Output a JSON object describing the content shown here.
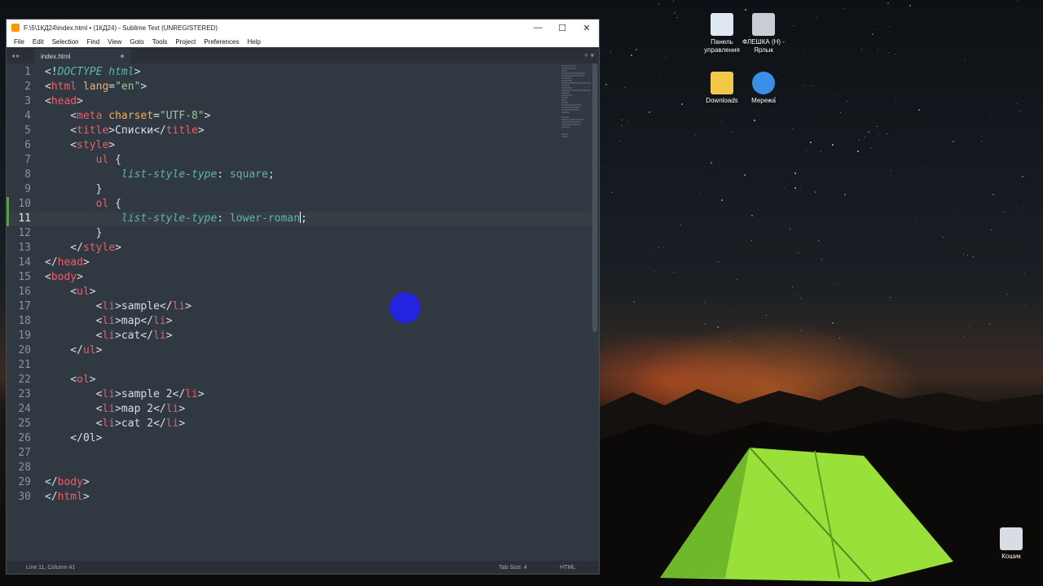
{
  "window": {
    "title": "F:\\5\\1КД24\\index.html • (1КД24) - Sublime Text (UNREGISTERED)",
    "controls": {
      "minimize": "—",
      "maximize": "☐",
      "close": "✕"
    }
  },
  "menu": [
    "File",
    "Edit",
    "Selection",
    "Find",
    "View",
    "Goto",
    "Tools",
    "Project",
    "Preferences",
    "Help"
  ],
  "tab": {
    "label": "index.html"
  },
  "code_lines": [
    [
      [
        "<!",
        "t-pun"
      ],
      [
        "DOCTYPE",
        "t-dt"
      ],
      [
        " ",
        "t-pun"
      ],
      [
        "html",
        "t-dt"
      ],
      [
        ">",
        "t-pun"
      ]
    ],
    [
      [
        "<",
        "t-pun"
      ],
      [
        "html",
        "t-tag"
      ],
      [
        " ",
        "t-pun"
      ],
      [
        "lang",
        "t-attr"
      ],
      [
        "=",
        "t-pun"
      ],
      [
        "\"en\"",
        "t-str"
      ],
      [
        ">",
        "t-pun"
      ]
    ],
    [
      [
        "<",
        "t-pun"
      ],
      [
        "head",
        "t-tag"
      ],
      [
        ">",
        "t-pun"
      ]
    ],
    [
      [
        "    <",
        "t-pun"
      ],
      [
        "meta",
        "t-tag"
      ],
      [
        " ",
        "t-pun"
      ],
      [
        "charset",
        "t-attr"
      ],
      [
        "=",
        "t-pun"
      ],
      [
        "\"UTF-8\"",
        "t-str"
      ],
      [
        ">",
        "t-pun"
      ]
    ],
    [
      [
        "    <",
        "t-pun"
      ],
      [
        "title",
        "t-tag"
      ],
      [
        ">Списки</",
        "t-pun"
      ],
      [
        "title",
        "t-tag"
      ],
      [
        ">",
        "t-pun"
      ]
    ],
    [
      [
        "    <",
        "t-pun"
      ],
      [
        "style",
        "t-tag"
      ],
      [
        ">",
        "t-pun"
      ]
    ],
    [
      [
        "        ",
        "t-pun"
      ],
      [
        "ul",
        "t-sel"
      ],
      [
        " {",
        "t-pun"
      ]
    ],
    [
      [
        "            ",
        "t-pun"
      ],
      [
        "list-style-type",
        "t-prop"
      ],
      [
        ": ",
        "t-pun"
      ],
      [
        "square",
        "t-val"
      ],
      [
        ";",
        "t-pun"
      ]
    ],
    [
      [
        "        }",
        "t-pun"
      ]
    ],
    [
      [
        "        ",
        "t-pun"
      ],
      [
        "ol",
        "t-sel"
      ],
      [
        " {",
        "t-pun"
      ]
    ],
    [
      [
        "            ",
        "t-pun"
      ],
      [
        "list-style-type",
        "t-prop"
      ],
      [
        ": ",
        "t-pun"
      ],
      [
        "lower-roman",
        "t-val"
      ],
      [
        "|CURSOR|",
        "cursor"
      ],
      [
        ";",
        "t-pun"
      ]
    ],
    [
      [
        "        }",
        "t-pun"
      ]
    ],
    [
      [
        "    </",
        "t-pun"
      ],
      [
        "style",
        "t-tag"
      ],
      [
        ">",
        "t-pun"
      ]
    ],
    [
      [
        "</",
        "t-pun"
      ],
      [
        "head",
        "t-tag"
      ],
      [
        ">",
        "t-pun"
      ]
    ],
    [
      [
        "<",
        "t-pun"
      ],
      [
        "body",
        "t-tag"
      ],
      [
        ">",
        "t-pun"
      ]
    ],
    [
      [
        "    <",
        "t-pun"
      ],
      [
        "ul",
        "t-tag"
      ],
      [
        ">",
        "t-pun"
      ]
    ],
    [
      [
        "        <",
        "t-pun"
      ],
      [
        "li",
        "t-tag"
      ],
      [
        ">sample</",
        "t-pun"
      ],
      [
        "li",
        "t-tag"
      ],
      [
        ">",
        "t-pun"
      ]
    ],
    [
      [
        "        <",
        "t-pun"
      ],
      [
        "li",
        "t-tag"
      ],
      [
        ">map</",
        "t-pun"
      ],
      [
        "li",
        "t-tag"
      ],
      [
        ">",
        "t-pun"
      ]
    ],
    [
      [
        "        <",
        "t-pun"
      ],
      [
        "li",
        "t-tag"
      ],
      [
        ">cat</",
        "t-pun"
      ],
      [
        "li",
        "t-tag"
      ],
      [
        ">",
        "t-pun"
      ]
    ],
    [
      [
        "    </",
        "t-pun"
      ],
      [
        "ul",
        "t-tag"
      ],
      [
        ">",
        "t-pun"
      ]
    ],
    [],
    [
      [
        "    <",
        "t-pun"
      ],
      [
        "ol",
        "t-tag"
      ],
      [
        ">",
        "t-pun"
      ]
    ],
    [
      [
        "        <",
        "t-pun"
      ],
      [
        "li",
        "t-tag"
      ],
      [
        ">sample 2</",
        "t-pun"
      ],
      [
        "li",
        "t-tag"
      ],
      [
        ">",
        "t-pun"
      ]
    ],
    [
      [
        "        <",
        "t-pun"
      ],
      [
        "li",
        "t-tag"
      ],
      [
        ">map 2</",
        "t-pun"
      ],
      [
        "li",
        "t-tag"
      ],
      [
        ">",
        "t-pun"
      ]
    ],
    [
      [
        "        <",
        "t-pun"
      ],
      [
        "li",
        "t-tag"
      ],
      [
        ">cat 2</",
        "t-pun"
      ],
      [
        "li",
        "t-tag"
      ],
      [
        ">",
        "t-pun"
      ]
    ],
    [
      [
        "    </0l>",
        "t-pun"
      ]
    ],
    [],
    [],
    [
      [
        "</",
        "t-pun"
      ],
      [
        "body",
        "t-tag"
      ],
      [
        ">",
        "t-pun"
      ]
    ],
    [
      [
        "</",
        "t-pun"
      ],
      [
        "html",
        "t-tag"
      ],
      [
        ">",
        "t-pun"
      ]
    ]
  ],
  "current_line": 11,
  "modified_lines": [
    10,
    11
  ],
  "status": {
    "position": "Line 11, Column 41",
    "tab_size": "Tab Size: 4",
    "syntax": "HTML"
  },
  "desktop_icons": [
    {
      "label": "Панель управления",
      "icon": "control-panel-icon",
      "color": "#dfe7f3"
    },
    {
      "label": "ФЛЕШКА (H) - Ярлык",
      "icon": "usb-drive-icon",
      "color": "#c9ced6"
    },
    {
      "label": "Downloads",
      "icon": "downloads-folder-icon",
      "color": "#f2c84b"
    },
    {
      "label": "Мережа",
      "icon": "network-icon",
      "color": "#3a8ee6"
    },
    {
      "label": "Кошик",
      "icon": "recycle-bin-icon",
      "color": "#d8dde3"
    }
  ],
  "colors": {
    "editor_bg": "#303841",
    "tag": "#ec5f66",
    "attr": "#f9ae58",
    "string": "#99c794",
    "keyword": "#5fb4b4",
    "tent": "#9ae03a"
  }
}
